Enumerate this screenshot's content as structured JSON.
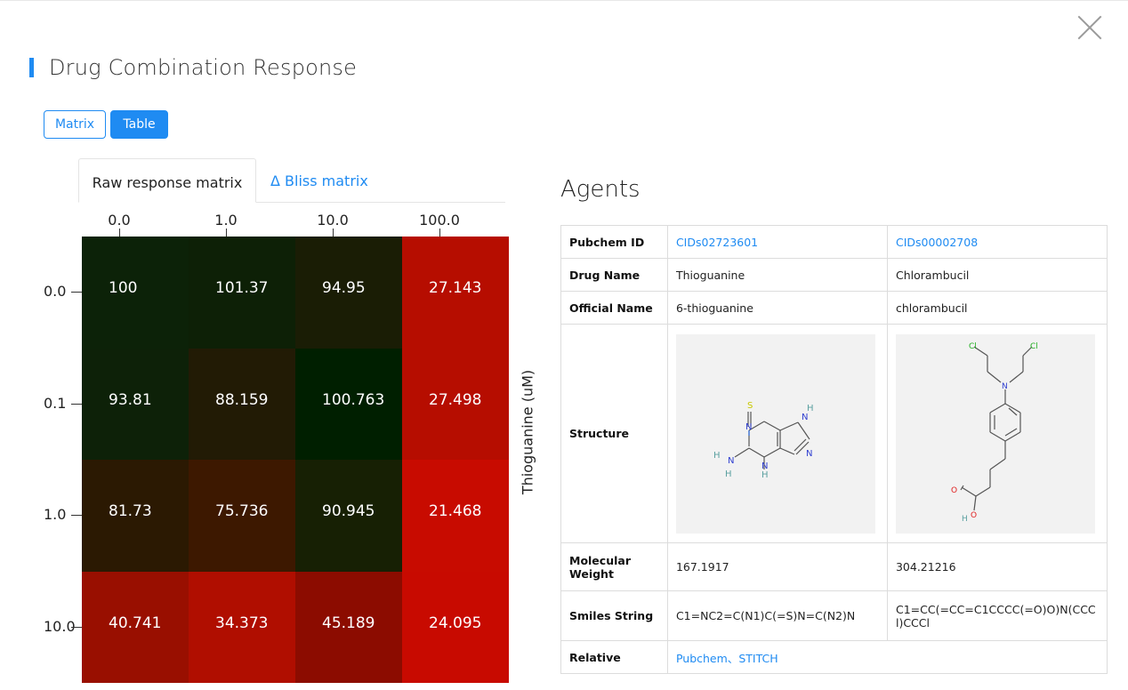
{
  "header": {
    "title": "Drug Combination Response",
    "close_icon": "close-icon"
  },
  "view_toggle": {
    "matrix_label": "Matrix",
    "table_label": "Table",
    "selected": "Table"
  },
  "tabs": [
    {
      "label": "Raw response matrix",
      "active": true
    },
    {
      "label": "Δ Bliss matrix",
      "active": false
    }
  ],
  "chart_data": {
    "type": "heatmap",
    "x_categories": [
      "0.0",
      "1.0",
      "10.0",
      "100.0"
    ],
    "y_categories": [
      "0.0",
      "0.1",
      "1.0",
      "10.0"
    ],
    "ylabel": "Thioguanine (uM)",
    "values": [
      [
        "100",
        "101.37",
        "94.95",
        "27.143"
      ],
      [
        "93.81",
        "88.159",
        "100.763",
        "27.498"
      ],
      [
        "81.73",
        "75.736",
        "90.945",
        "21.468"
      ],
      [
        "40.741",
        "34.373",
        "45.189",
        "24.095"
      ]
    ],
    "colors": [
      [
        "#0c2208",
        "#0d2006",
        "#1a1d05",
        "#b60d00"
      ],
      [
        "#0d2108",
        "#221b05",
        "#001f00",
        "#b60d00"
      ],
      [
        "#2b1902",
        "#3d1800",
        "#172004",
        "#c80b00"
      ],
      [
        "#990f00",
        "#b00e00",
        "#8c0c00",
        "#c80a00"
      ]
    ]
  },
  "agents": {
    "heading": "Agents",
    "rows": {
      "pubchem": {
        "label": "Pubchem ID",
        "a": "CIDs02723601",
        "b": "CIDs00002708"
      },
      "drug_name": {
        "label": "Drug Name",
        "a": "Thioguanine",
        "b": "Chlorambucil"
      },
      "official_name": {
        "label": "Official Name",
        "a": "6-thioguanine",
        "b": "chlorambucil"
      },
      "structure": {
        "label": "Structure"
      },
      "mw": {
        "label": "Molecular Weight",
        "a": "167.1917",
        "b": "304.21216"
      },
      "smiles": {
        "label": "Smiles String",
        "a": "C1=NC2=C(N1)C(=S)N=C(N2)N",
        "b": "C1=CC(=CC=C1CCCC(=O)O)N(CCCl)CCCl"
      },
      "relative": {
        "label": "Relative",
        "link1": "Pubchem",
        "sep": "、",
        "link2": "STITCH"
      }
    }
  },
  "structure_atoms": {
    "thioguanine": {
      "S": "S",
      "N": "N",
      "H": "H"
    },
    "chlorambucil": {
      "Cl": "Cl",
      "N": "N",
      "O": "O",
      "H": "H"
    }
  }
}
